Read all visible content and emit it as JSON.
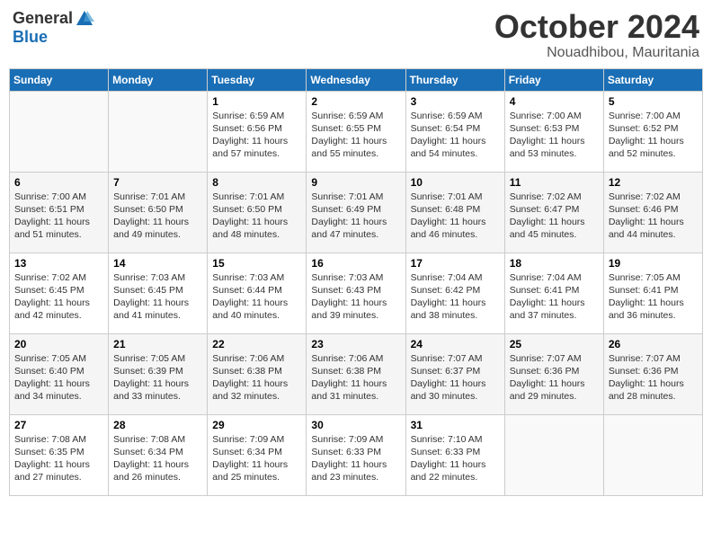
{
  "header": {
    "logo_general": "General",
    "logo_blue": "Blue",
    "month": "October 2024",
    "location": "Nouadhibou, Mauritania"
  },
  "weekdays": [
    "Sunday",
    "Monday",
    "Tuesday",
    "Wednesday",
    "Thursday",
    "Friday",
    "Saturday"
  ],
  "weeks": [
    [
      {
        "day": "",
        "sunrise": "",
        "sunset": "",
        "daylight": ""
      },
      {
        "day": "",
        "sunrise": "",
        "sunset": "",
        "daylight": ""
      },
      {
        "day": "1",
        "sunrise": "Sunrise: 6:59 AM",
        "sunset": "Sunset: 6:56 PM",
        "daylight": "Daylight: 11 hours and 57 minutes."
      },
      {
        "day": "2",
        "sunrise": "Sunrise: 6:59 AM",
        "sunset": "Sunset: 6:55 PM",
        "daylight": "Daylight: 11 hours and 55 minutes."
      },
      {
        "day": "3",
        "sunrise": "Sunrise: 6:59 AM",
        "sunset": "Sunset: 6:54 PM",
        "daylight": "Daylight: 11 hours and 54 minutes."
      },
      {
        "day": "4",
        "sunrise": "Sunrise: 7:00 AM",
        "sunset": "Sunset: 6:53 PM",
        "daylight": "Daylight: 11 hours and 53 minutes."
      },
      {
        "day": "5",
        "sunrise": "Sunrise: 7:00 AM",
        "sunset": "Sunset: 6:52 PM",
        "daylight": "Daylight: 11 hours and 52 minutes."
      }
    ],
    [
      {
        "day": "6",
        "sunrise": "Sunrise: 7:00 AM",
        "sunset": "Sunset: 6:51 PM",
        "daylight": "Daylight: 11 hours and 51 minutes."
      },
      {
        "day": "7",
        "sunrise": "Sunrise: 7:01 AM",
        "sunset": "Sunset: 6:50 PM",
        "daylight": "Daylight: 11 hours and 49 minutes."
      },
      {
        "day": "8",
        "sunrise": "Sunrise: 7:01 AM",
        "sunset": "Sunset: 6:50 PM",
        "daylight": "Daylight: 11 hours and 48 minutes."
      },
      {
        "day": "9",
        "sunrise": "Sunrise: 7:01 AM",
        "sunset": "Sunset: 6:49 PM",
        "daylight": "Daylight: 11 hours and 47 minutes."
      },
      {
        "day": "10",
        "sunrise": "Sunrise: 7:01 AM",
        "sunset": "Sunset: 6:48 PM",
        "daylight": "Daylight: 11 hours and 46 minutes."
      },
      {
        "day": "11",
        "sunrise": "Sunrise: 7:02 AM",
        "sunset": "Sunset: 6:47 PM",
        "daylight": "Daylight: 11 hours and 45 minutes."
      },
      {
        "day": "12",
        "sunrise": "Sunrise: 7:02 AM",
        "sunset": "Sunset: 6:46 PM",
        "daylight": "Daylight: 11 hours and 44 minutes."
      }
    ],
    [
      {
        "day": "13",
        "sunrise": "Sunrise: 7:02 AM",
        "sunset": "Sunset: 6:45 PM",
        "daylight": "Daylight: 11 hours and 42 minutes."
      },
      {
        "day": "14",
        "sunrise": "Sunrise: 7:03 AM",
        "sunset": "Sunset: 6:45 PM",
        "daylight": "Daylight: 11 hours and 41 minutes."
      },
      {
        "day": "15",
        "sunrise": "Sunrise: 7:03 AM",
        "sunset": "Sunset: 6:44 PM",
        "daylight": "Daylight: 11 hours and 40 minutes."
      },
      {
        "day": "16",
        "sunrise": "Sunrise: 7:03 AM",
        "sunset": "Sunset: 6:43 PM",
        "daylight": "Daylight: 11 hours and 39 minutes."
      },
      {
        "day": "17",
        "sunrise": "Sunrise: 7:04 AM",
        "sunset": "Sunset: 6:42 PM",
        "daylight": "Daylight: 11 hours and 38 minutes."
      },
      {
        "day": "18",
        "sunrise": "Sunrise: 7:04 AM",
        "sunset": "Sunset: 6:41 PM",
        "daylight": "Daylight: 11 hours and 37 minutes."
      },
      {
        "day": "19",
        "sunrise": "Sunrise: 7:05 AM",
        "sunset": "Sunset: 6:41 PM",
        "daylight": "Daylight: 11 hours and 36 minutes."
      }
    ],
    [
      {
        "day": "20",
        "sunrise": "Sunrise: 7:05 AM",
        "sunset": "Sunset: 6:40 PM",
        "daylight": "Daylight: 11 hours and 34 minutes."
      },
      {
        "day": "21",
        "sunrise": "Sunrise: 7:05 AM",
        "sunset": "Sunset: 6:39 PM",
        "daylight": "Daylight: 11 hours and 33 minutes."
      },
      {
        "day": "22",
        "sunrise": "Sunrise: 7:06 AM",
        "sunset": "Sunset: 6:38 PM",
        "daylight": "Daylight: 11 hours and 32 minutes."
      },
      {
        "day": "23",
        "sunrise": "Sunrise: 7:06 AM",
        "sunset": "Sunset: 6:38 PM",
        "daylight": "Daylight: 11 hours and 31 minutes."
      },
      {
        "day": "24",
        "sunrise": "Sunrise: 7:07 AM",
        "sunset": "Sunset: 6:37 PM",
        "daylight": "Daylight: 11 hours and 30 minutes."
      },
      {
        "day": "25",
        "sunrise": "Sunrise: 7:07 AM",
        "sunset": "Sunset: 6:36 PM",
        "daylight": "Daylight: 11 hours and 29 minutes."
      },
      {
        "day": "26",
        "sunrise": "Sunrise: 7:07 AM",
        "sunset": "Sunset: 6:36 PM",
        "daylight": "Daylight: 11 hours and 28 minutes."
      }
    ],
    [
      {
        "day": "27",
        "sunrise": "Sunrise: 7:08 AM",
        "sunset": "Sunset: 6:35 PM",
        "daylight": "Daylight: 11 hours and 27 minutes."
      },
      {
        "day": "28",
        "sunrise": "Sunrise: 7:08 AM",
        "sunset": "Sunset: 6:34 PM",
        "daylight": "Daylight: 11 hours and 26 minutes."
      },
      {
        "day": "29",
        "sunrise": "Sunrise: 7:09 AM",
        "sunset": "Sunset: 6:34 PM",
        "daylight": "Daylight: 11 hours and 25 minutes."
      },
      {
        "day": "30",
        "sunrise": "Sunrise: 7:09 AM",
        "sunset": "Sunset: 6:33 PM",
        "daylight": "Daylight: 11 hours and 23 minutes."
      },
      {
        "day": "31",
        "sunrise": "Sunrise: 7:10 AM",
        "sunset": "Sunset: 6:33 PM",
        "daylight": "Daylight: 11 hours and 22 minutes."
      },
      {
        "day": "",
        "sunrise": "",
        "sunset": "",
        "daylight": ""
      },
      {
        "day": "",
        "sunrise": "",
        "sunset": "",
        "daylight": ""
      }
    ]
  ]
}
